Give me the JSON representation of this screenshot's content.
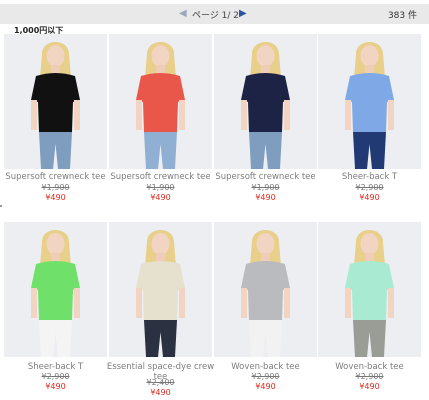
{
  "pager": {
    "prev_icon": "triangle-left-icon",
    "label": "ページ 1/ 2",
    "next_icon": "triangle-right-icon",
    "count": "383 件"
  },
  "filter_label": "1,000円以下",
  "products": [
    {
      "name": "Supersoft crewneck tee",
      "old_price": "¥1,900",
      "price": "¥490",
      "shirt_color": "#111111",
      "pants_color": "#7f9dbf"
    },
    {
      "name": "Supersoft crewneck tee",
      "old_price": "¥1,900",
      "price": "¥490",
      "shirt_color": "#e8574a",
      "pants_color": "#8fb0d2"
    },
    {
      "name": "Supersoft crewneck tee",
      "old_price": "¥1,900",
      "price": "¥490",
      "shirt_color": "#1d2344",
      "pants_color": "#7f9dbf"
    },
    {
      "name": "Sheer-back T",
      "old_price": "¥2,900",
      "price": "¥490",
      "shirt_color": "#7fa8e6",
      "pants_color": "#213a74"
    },
    {
      "name": "Sheer-back T",
      "old_price": "¥2,900",
      "price": "¥490",
      "shirt_color": "#6fe06a",
      "pants_color": "#f4f4f4"
    },
    {
      "name": "Essential space-dye crew tee",
      "old_price": "¥2,400",
      "price": "¥490",
      "shirt_color": "#e6e1cf",
      "pants_color": "#2c3142"
    },
    {
      "name": "Woven-back tee",
      "old_price": "¥2,900",
      "price": "¥490",
      "shirt_color": "#b9bbbf",
      "pants_color": "#f2f2f2"
    },
    {
      "name": "Woven-back tee",
      "old_price": "¥2,900",
      "price": "¥490",
      "shirt_color": "#a9ead3",
      "pants_color": "#9a9c96"
    }
  ]
}
